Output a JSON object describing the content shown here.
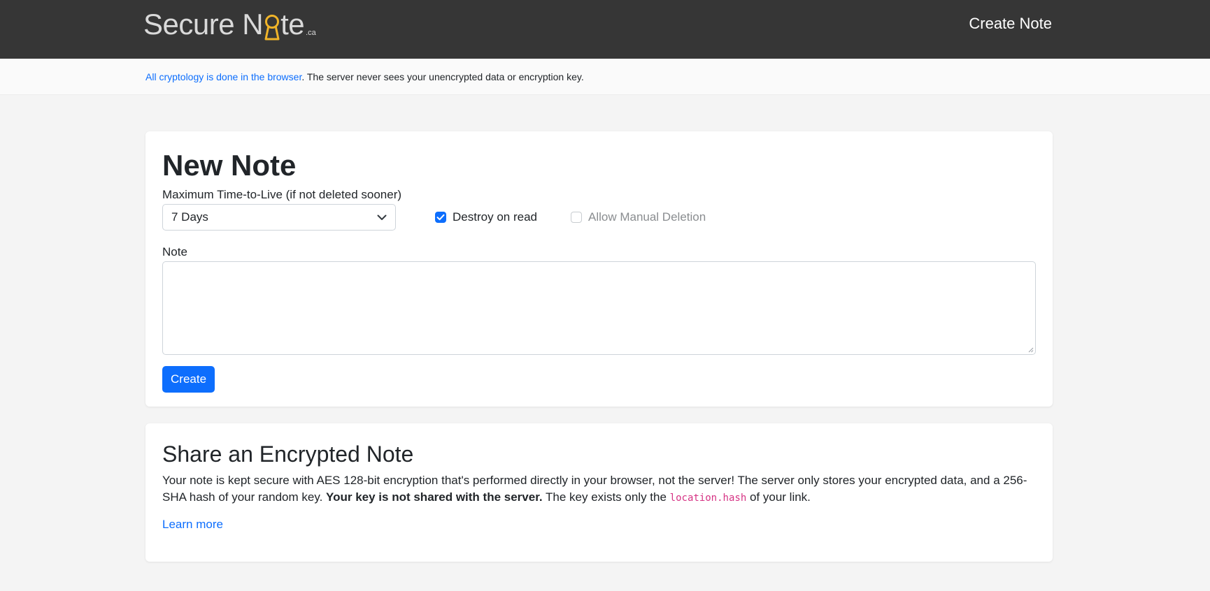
{
  "navbar": {
    "brand_before": "Secure N",
    "brand_after": "te",
    "brand_suffix": ".ca",
    "brand_icon": "keyhole-icon",
    "brand_icon_color": "#f0b429",
    "create_note_link": "Create Note"
  },
  "infobar": {
    "link_text": "All cryptology is done in the browser",
    "rest_text": ". The server never sees your unencrypted data or encryption key."
  },
  "new_note": {
    "title": "New Note",
    "ttl_label": "Maximum Time-to-Live (if not deleted sooner)",
    "ttl_selected": "7 Days",
    "destroy_on_read_label": "Destroy on read",
    "destroy_on_read_checked": true,
    "allow_manual_deletion_label": "Allow Manual Deletion",
    "allow_manual_deletion_checked": false,
    "note_label": "Note",
    "note_value": "",
    "create_button": "Create"
  },
  "share": {
    "title": "Share an Encrypted Note",
    "body_part1": "Your note is kept secure with AES 128-bit encryption that's performed directly in your browser, not the server! The server only stores your encrypted data, and a 256-SHA hash of your random key. ",
    "body_bold": "Your key is not shared with the server.",
    "body_part2": " The key exists only the ",
    "body_code": "location.hash",
    "body_part3": " of your link.",
    "learn_more": "Learn more"
  },
  "colors": {
    "navbar_bg": "#363636",
    "accent": "#0d6efd",
    "code": "#d63384"
  }
}
